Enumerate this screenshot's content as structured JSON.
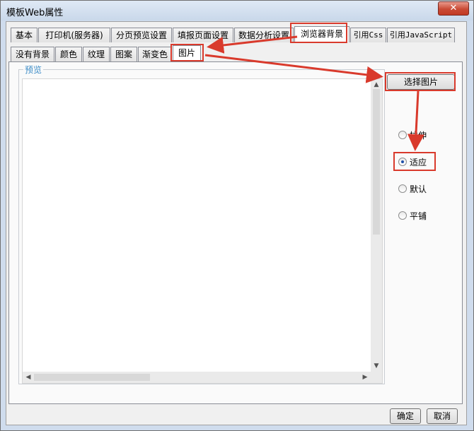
{
  "window": {
    "title": "模板Web属性",
    "close_label": "✕"
  },
  "main_tabs": [
    "基本",
    "打印机(服务器)",
    "分页预览设置",
    "填报页面设置",
    "数据分析设置",
    "浏览器背景",
    "引用Css",
    "引用JavaScript"
  ],
  "background_tabs": [
    "没有背景",
    "颜色",
    "纹理",
    "图案",
    "渐变色",
    "图片"
  ],
  "preview": {
    "legend": "预览"
  },
  "select_image_button": "选择图片",
  "layout_options": [
    {
      "label": "拉伸",
      "checked": false
    },
    {
      "label": "适应",
      "checked": true
    },
    {
      "label": "默认",
      "checked": false
    },
    {
      "label": "平铺",
      "checked": false
    }
  ],
  "footer": {
    "ok_label": "确定",
    "cancel_label": "取消"
  },
  "colors": {
    "annotation": "#d93a2c",
    "title_bar": "#dfe9f5",
    "legend_text": "#3c8cc7"
  }
}
